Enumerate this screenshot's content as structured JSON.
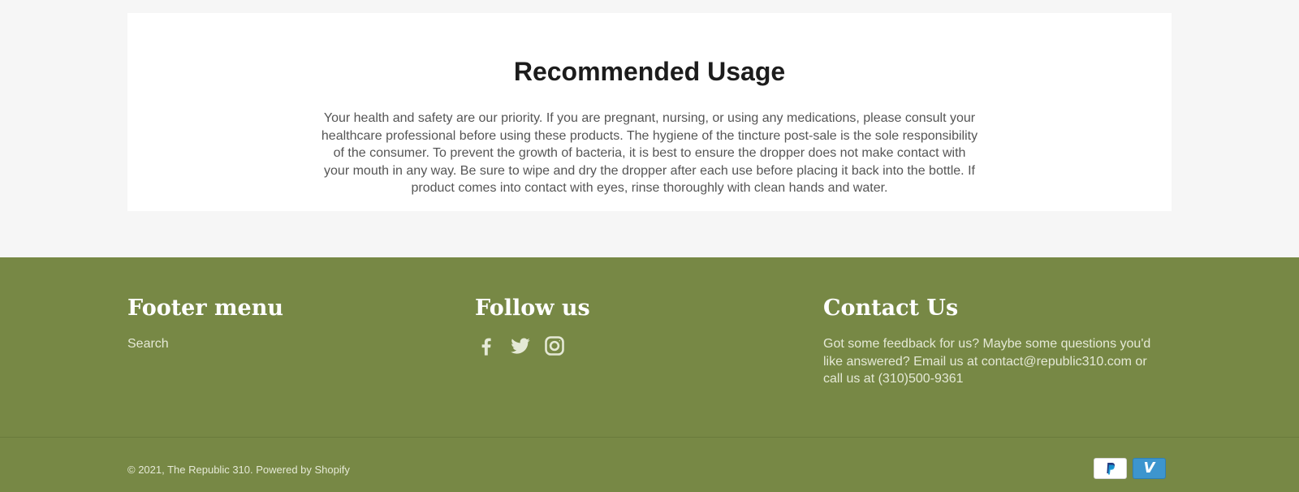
{
  "usage": {
    "title": "Recommended Usage",
    "body": "Your health and safety are our priority. If you are pregnant, nursing, or using any medications, please consult your healthcare professional before using these products. The hygiene of the tincture post-sale is the sole responsibility of the consumer. To prevent the growth of bacteria, it is best to ensure the dropper does not make contact with your mouth in any way. Be sure to wipe and dry the dropper after each use before placing it back into the bottle. If product comes into contact with eyes, rinse thoroughly with clean hands and water."
  },
  "footer": {
    "background_color": "#778845",
    "menu": {
      "heading": "Footer menu",
      "links": [
        "Search"
      ]
    },
    "follow": {
      "heading": "Follow us",
      "icons": [
        "facebook-icon",
        "twitter-icon",
        "instagram-icon"
      ]
    },
    "contact": {
      "heading": "Contact Us",
      "text": "Got some feedback for us? Maybe some questions you'd like answered? Email us at contact@republic310.com or call us at (310)500-9361"
    },
    "copyright": {
      "prefix": "© 2021, ",
      "store_link": "The Republic 310",
      "separator": ". ",
      "powered_link": "Powered by Shopify"
    },
    "payments": [
      "paypal-icon",
      "venmo-icon"
    ]
  }
}
